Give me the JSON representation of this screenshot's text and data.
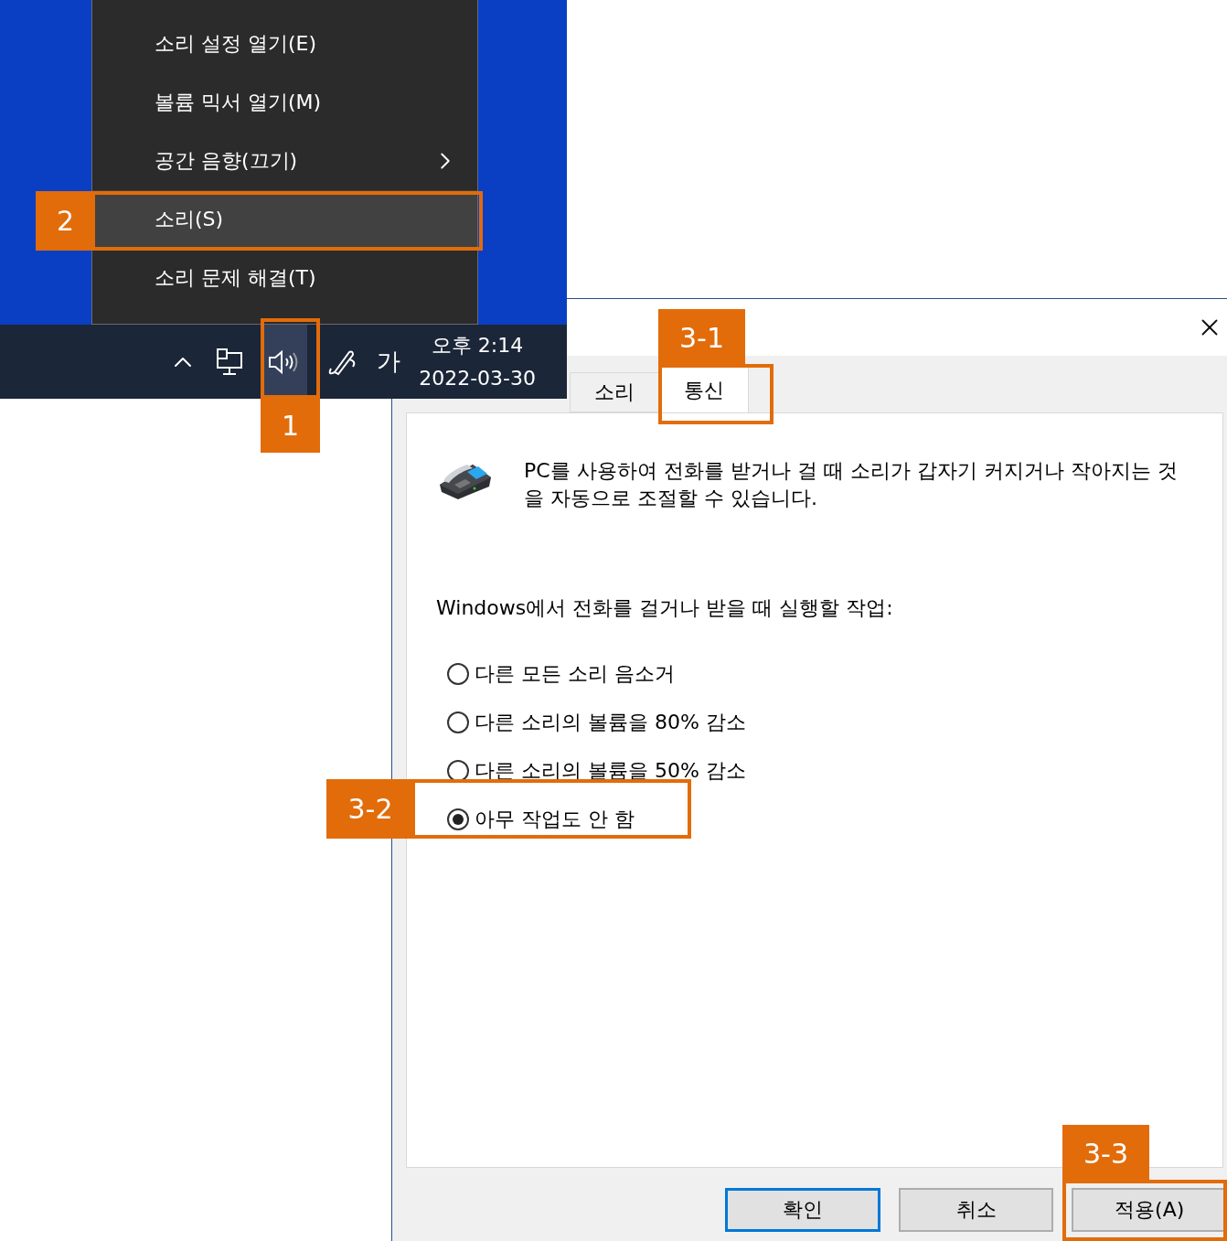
{
  "context_menu": {
    "items": [
      {
        "label": "소리 설정 열기(E)",
        "selected": false,
        "submenu": false
      },
      {
        "label": "볼륨 믹서 열기(M)",
        "selected": false,
        "submenu": false
      },
      {
        "label": "공간 음향(끄기)",
        "selected": false,
        "submenu": true
      },
      {
        "label": "소리(S)",
        "selected": true,
        "submenu": false
      },
      {
        "label": "소리 문제 해결(T)",
        "selected": false,
        "submenu": false
      }
    ]
  },
  "taskbar": {
    "ime": "가",
    "time": "오후 2:14",
    "date": "2022-03-30",
    "volume_selected": true
  },
  "dialog": {
    "tabs": [
      {
        "label": "소리",
        "selected": false
      },
      {
        "label": "통신",
        "selected": true
      }
    ],
    "description": "PC를 사용하여 전화를 받거나 걸 때 소리가 갑자기 커지거나 작아지는 것을 자동으로 조절할 수 있습니다.",
    "prompt": "Windows에서 전화를 걸거나 받을 때 실행할 작업:",
    "options": [
      {
        "label": "다른 모든 소리 음소거",
        "selected": false
      },
      {
        "label": "다른 소리의 볼륨을 80% 감소",
        "selected": false
      },
      {
        "label": "다른 소리의 볼륨을 50% 감소",
        "selected": false
      },
      {
        "label": "아무 작업도 안 함",
        "selected": true
      }
    ],
    "buttons": [
      {
        "label": "확인",
        "default": true
      },
      {
        "label": "취소",
        "default": false
      },
      {
        "label": "적용(A)",
        "default": false
      }
    ]
  },
  "annotations": [
    {
      "label": "1"
    },
    {
      "label": "2"
    },
    {
      "label": "3-1"
    },
    {
      "label": "3-2"
    },
    {
      "label": "3-3"
    }
  ]
}
